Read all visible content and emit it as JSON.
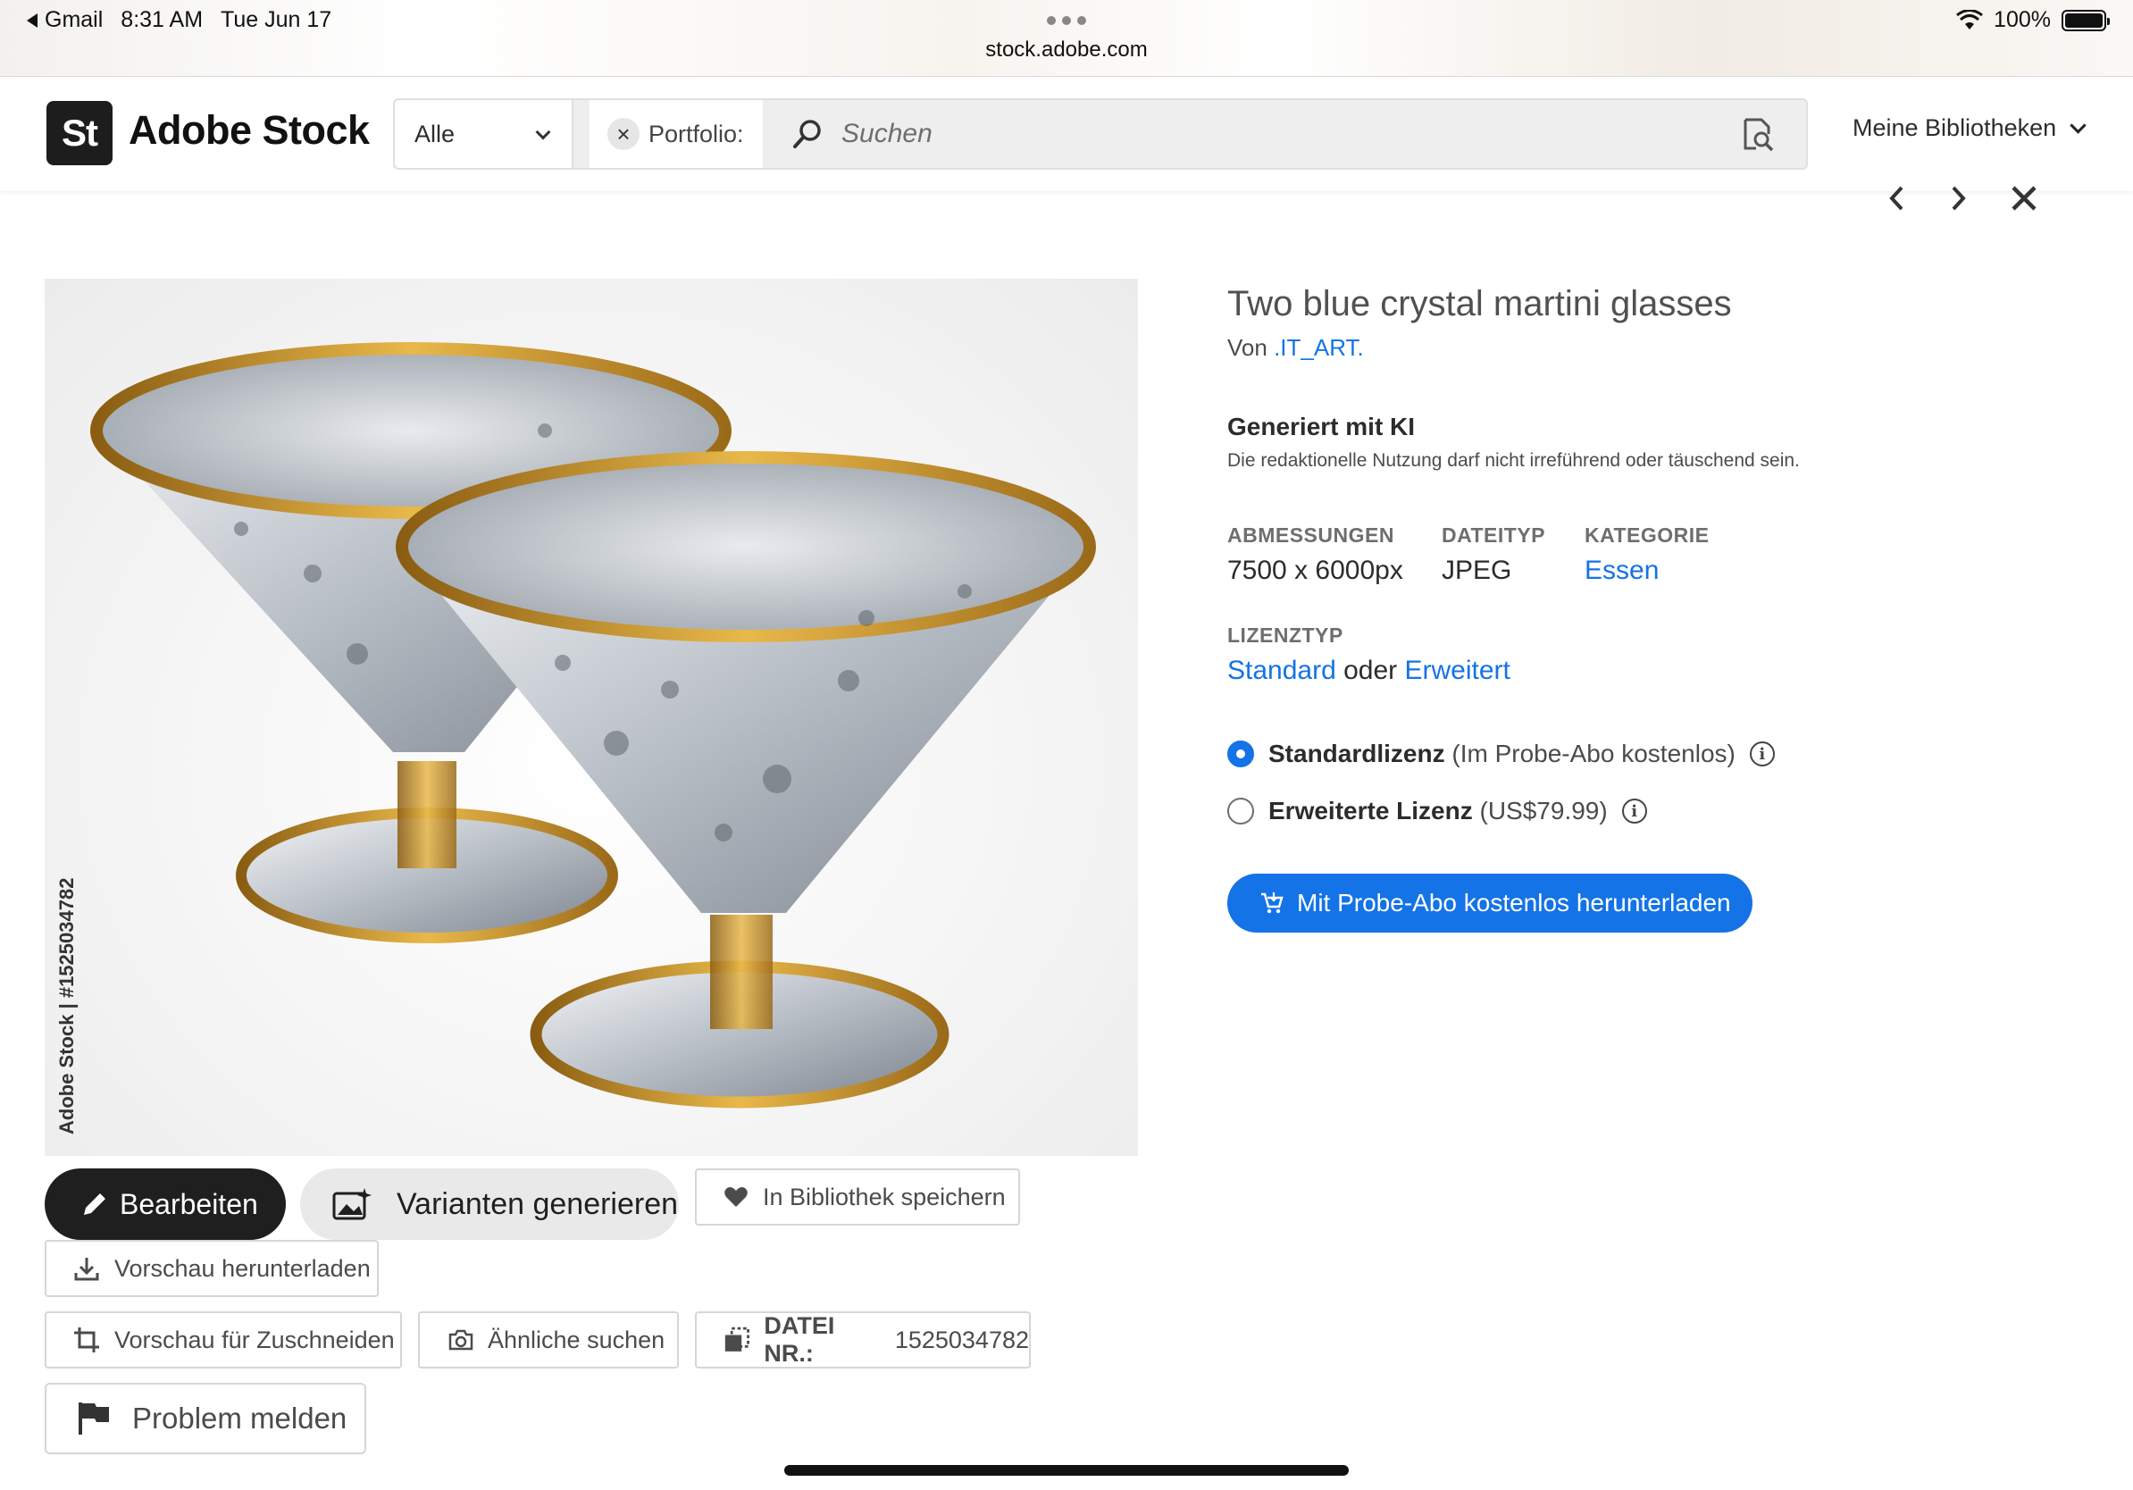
{
  "status_bar": {
    "back_app": "Gmail",
    "time": "8:31 AM",
    "date": "Tue Jun 17",
    "url": "stock.adobe.com",
    "battery": "100%"
  },
  "header": {
    "logo_mark": "St",
    "logo_text": "Adobe Stock",
    "category_select": "Alle",
    "filter_chip": "Portfolio:",
    "search_placeholder": "Suchen",
    "libraries": "Meine Bibliotheken"
  },
  "asset": {
    "title": "Two blue crystal martini glasses",
    "by_prefix": "Von",
    "author": ".IT_ART.",
    "ai_heading": "Generiert mit KI",
    "ai_note": "Die redaktionelle Nutzung darf nicht irreführend oder täuschend sein.",
    "dimensions_label": "ABMESSUNGEN",
    "dimensions_value": "7500 x 6000px",
    "filetype_label": "DATEITYP",
    "filetype_value": "JPEG",
    "category_label": "KATEGORIE",
    "category_value": "Essen",
    "license_type_label": "LIZENZTYP",
    "license_standard": "Standard",
    "license_or": "oder",
    "license_extended": "Erweitert",
    "watermark_side": "Adobe Stock | #1525034782"
  },
  "license_options": [
    {
      "name": "Standardlizenz",
      "detail": "(Im Probe-Abo kostenlos)",
      "selected": true
    },
    {
      "name": "Erweiterte Lizenz",
      "detail": "(US$79.99)",
      "selected": false
    }
  ],
  "download_button": "Mit Probe-Abo kostenlos herunterladen",
  "actions": {
    "edit": "Bearbeiten",
    "generate_variants": "Varianten generieren",
    "save_library": "In Bibliothek speichern",
    "download_preview": "Vorschau herunterladen",
    "crop_preview": "Vorschau für Zuschneiden",
    "find_similar": "Ähnliche suchen",
    "file_label": "DATEI NR.:",
    "file_number": "1525034782",
    "report": "Problem melden"
  },
  "colors": {
    "accent": "#1473e6",
    "dark_button": "#1f1f1f",
    "gold": "#c9962b"
  }
}
